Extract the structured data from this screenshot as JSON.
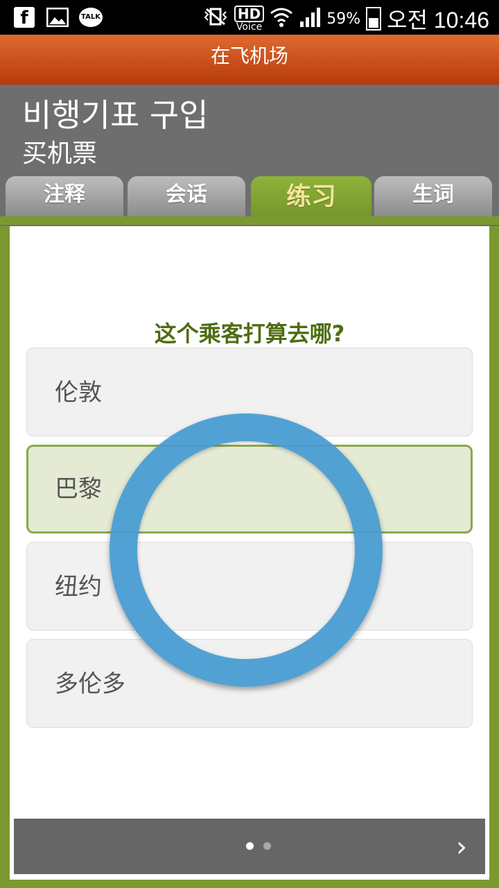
{
  "status_bar": {
    "left_icons": [
      "facebook-icon",
      "gallery-icon",
      "kakaotalk-icon"
    ],
    "facebook_label": "f",
    "talk_label": "TALK",
    "hd_top": "HD",
    "hd_bottom": "Voice",
    "battery_percent": "59%",
    "time": "오전 10:46"
  },
  "header": {
    "title": "在飞机场"
  },
  "lesson": {
    "title_ko": "비행기표 구입",
    "title_zh": "买机票"
  },
  "tabs": [
    {
      "label": "注释",
      "active": false
    },
    {
      "label": "会话",
      "active": false
    },
    {
      "label": "练习",
      "active": true
    },
    {
      "label": "生词",
      "active": false
    }
  ],
  "quiz": {
    "question": "这个乘客打算去哪?",
    "options": [
      {
        "label": "伦敦",
        "selected": false
      },
      {
        "label": "巴黎",
        "selected": true
      },
      {
        "label": "纽约",
        "selected": false
      },
      {
        "label": "多伦多",
        "selected": false
      }
    ]
  },
  "pager": {
    "pages": 2,
    "current_page": 1,
    "next_icon": "chevron-right-icon",
    "next_glyph": "›"
  },
  "colors": {
    "accent_orange": "#c8501c",
    "accent_green": "#7a9a30",
    "question_green": "#4e6d12",
    "ring_blue": "#469bd2"
  }
}
